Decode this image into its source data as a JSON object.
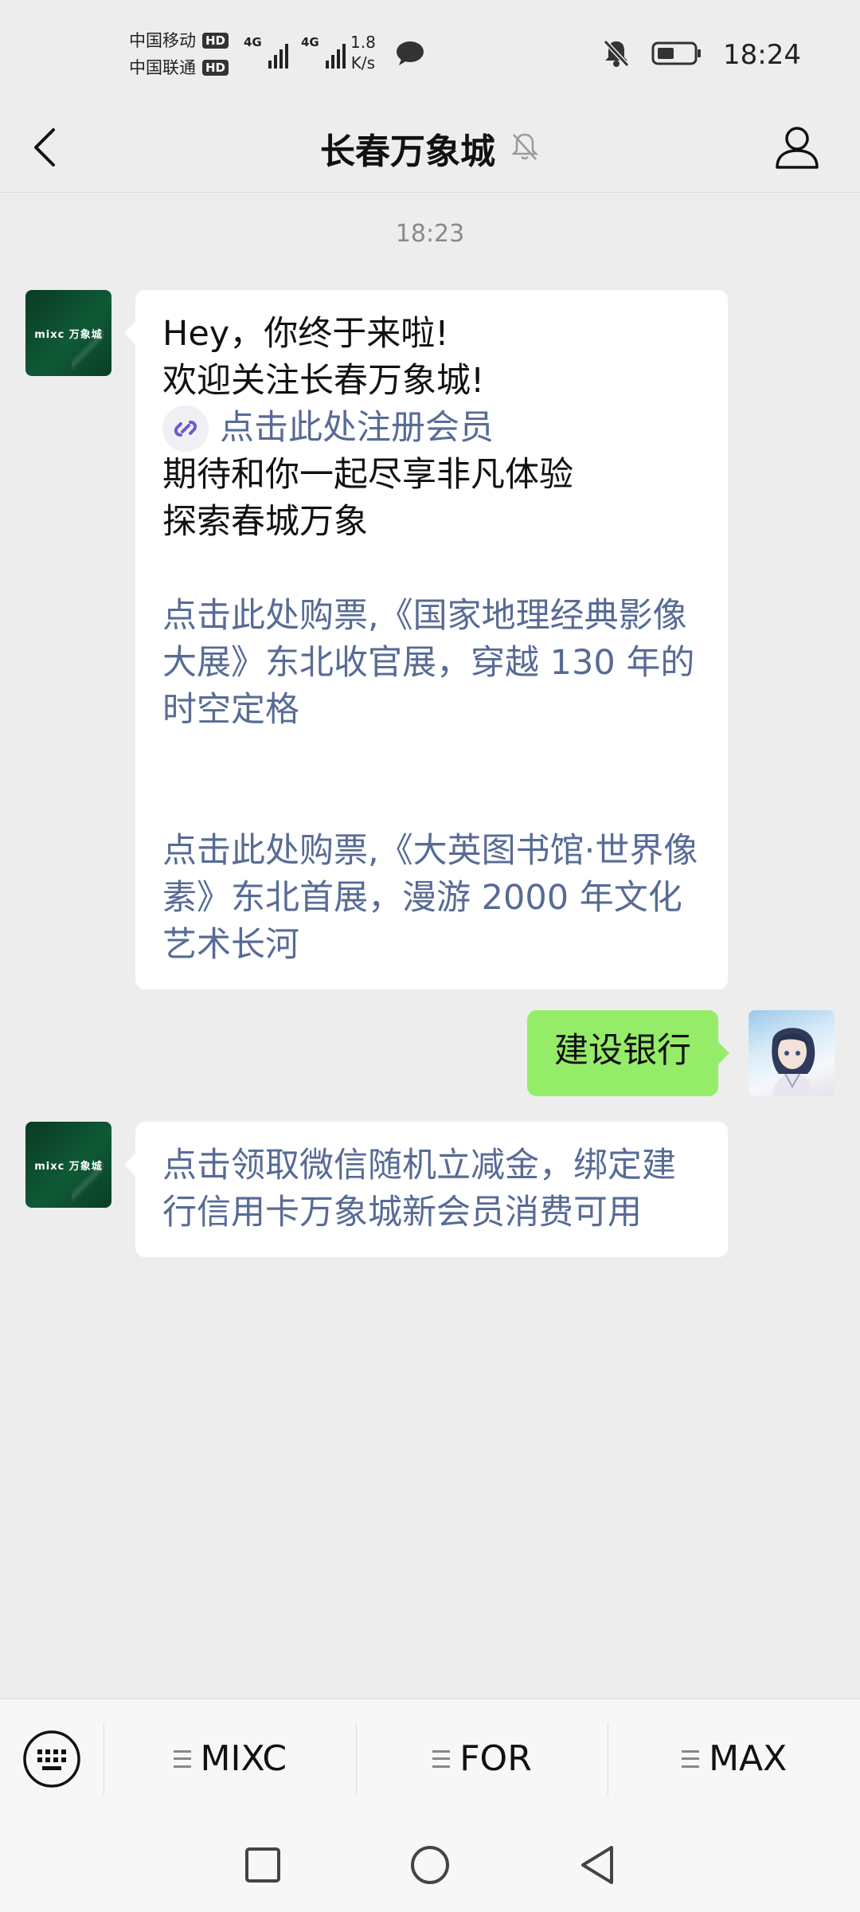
{
  "status_bar": {
    "carrier1": "中国移动",
    "carrier2": "中国联通",
    "hd": "HD",
    "net_type": "4G",
    "net_speed_value": "1.8",
    "net_speed_unit": "K/s",
    "time": "18:24"
  },
  "header": {
    "title": "长春万象城"
  },
  "chat": {
    "timestamp": "18:23",
    "messages": [
      {
        "sender": "official",
        "lines": [
          "Hey，你终于来啦!",
          "欢迎关注长春万象城!"
        ],
        "mini_program_link": "点击此处注册会员",
        "lines_after": [
          "期待和你一起尽享非凡体验",
          "探索春城万象"
        ],
        "link1": "点击此处购票,《国家地理经典影像大展》东北收官展，穿越 130 年的时空定格",
        "link2": "点击此处购票,《大英图书馆·世界像素》东北首展，漫游 2000 年文化艺术长河"
      },
      {
        "sender": "user",
        "text": "建设银行"
      },
      {
        "sender": "official",
        "link": "点击领取微信随机立减金，绑定建行信用卡万象城新会员消费可用"
      }
    ],
    "official_logo_text": "mixc 万象城"
  },
  "menu": {
    "items": [
      "MIXC",
      "FOR",
      "MAX"
    ]
  }
}
